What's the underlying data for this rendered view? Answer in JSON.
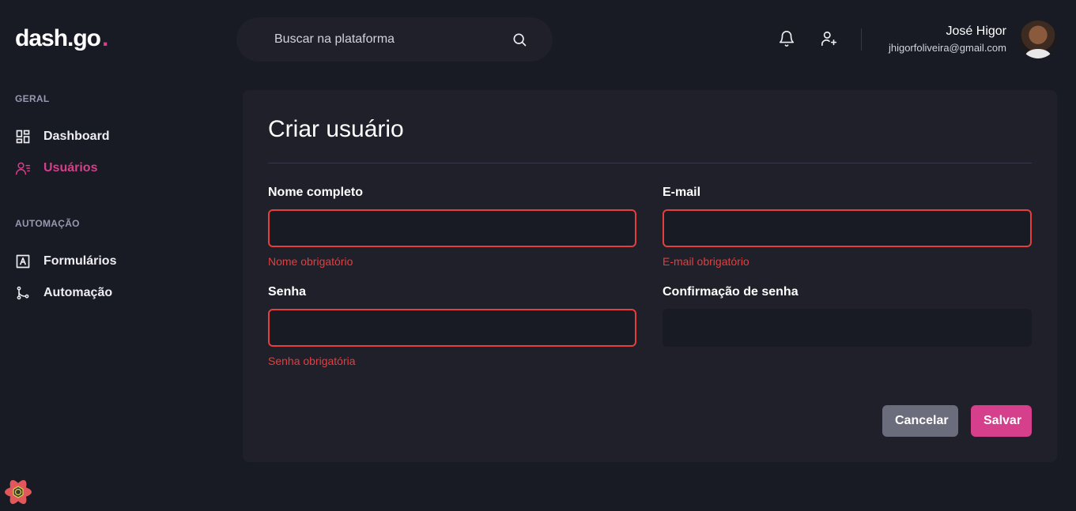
{
  "app": {
    "logo_text": "dash.go",
    "logo_dot": "."
  },
  "search": {
    "placeholder": "Buscar na plataforma",
    "icon": "search-icon"
  },
  "header": {
    "icons": [
      "bell-icon",
      "user-plus-icon"
    ],
    "user": {
      "name": "José Higor",
      "email": "jhigorfoliveira@gmail.com"
    }
  },
  "sidebar": {
    "sections": [
      {
        "title": "GERAL",
        "items": [
          {
            "label": "Dashboard",
            "icon": "dashboard-icon",
            "active": false
          },
          {
            "label": "Usuários",
            "icon": "users-icon",
            "active": true
          }
        ]
      },
      {
        "title": "AUTOMAÇÃO",
        "items": [
          {
            "label": "Formulários",
            "icon": "form-icon",
            "active": false
          },
          {
            "label": "Automação",
            "icon": "git-branch-icon",
            "active": false
          }
        ]
      }
    ]
  },
  "form": {
    "title": "Criar usuário",
    "fields": {
      "name": {
        "label": "Nome completo",
        "value": "",
        "error": "Nome obrigatório"
      },
      "email": {
        "label": "E-mail",
        "value": "",
        "error": "E-mail obrigatório"
      },
      "password": {
        "label": "Senha",
        "value": "",
        "error": "Senha obrigatória"
      },
      "password_confirmation": {
        "label": "Confirmação de senha",
        "value": "",
        "error": ""
      }
    },
    "buttons": {
      "cancel": "Cancelar",
      "save": "Salvar"
    }
  },
  "colors": {
    "accent": "#d53f8c",
    "error": "#e53e3e",
    "background": "#181b23",
    "card": "#1f2029"
  }
}
